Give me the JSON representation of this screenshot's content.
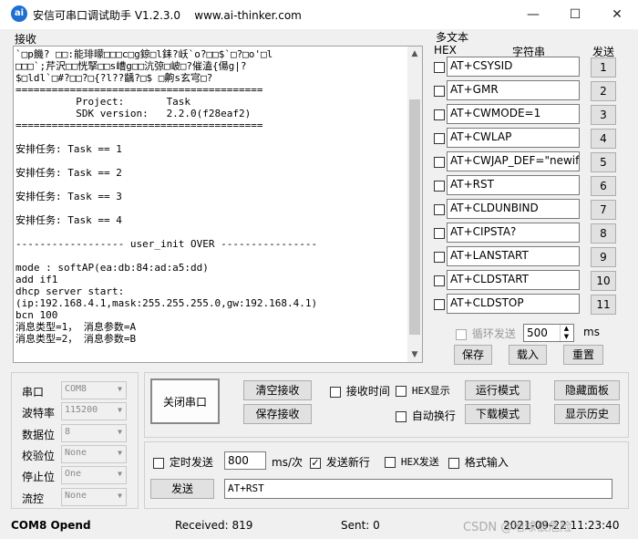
{
  "titlebar": {
    "icon_text": "ai",
    "title": "安信可串口调试助手 V1.2.3.0    www.ai-thinker.com",
    "minimize": "—",
    "maximize": "☐",
    "close": "✕"
  },
  "receive": {
    "label": "接收",
    "text": "`□p饑? □□:能琲曚□□□c□g鍄□l銇?岆`o?□□$`□?□o'□l\n□□□`;芹沢□□恍掔□□s嶆g□□沆弶□岥□?催溘{偒g|?\n$□ldl`□#?□□?□{?l??齲?□$ □齁s玄宆□?\n=========================================\n          Project:       Task\n          SDK version:   2.2.0(f28eaf2)\n=========================================\n\n安排任务: Task == 1\n\n安排任务: Task == 2\n\n安排任务: Task == 3\n\n安排任务: Task == 4\n\n------------------ user_init OVER ----------------\n\nmode : softAP(ea:db:84:ad:a5:dd)\nadd if1\ndhcp server start:\n(ip:192.168.4.1,mask:255.255.255.0,gw:192.168.4.1)\nbcn 100\n消息类型=1， 消息参数=A\n消息类型=2， 消息参数=B"
  },
  "multi_text": {
    "label": "多文本",
    "col_hex": "HEX",
    "col_string": "字符串",
    "col_send": "发送",
    "rows": [
      {
        "value": "AT+CSYSID",
        "num": "1"
      },
      {
        "value": "AT+GMR",
        "num": "2"
      },
      {
        "value": "AT+CWMODE=1",
        "num": "3"
      },
      {
        "value": "AT+CWLAP",
        "num": "4"
      },
      {
        "value": "AT+CWJAP_DEF=\"newifi_",
        "num": "5"
      },
      {
        "value": "AT+RST",
        "num": "6"
      },
      {
        "value": "AT+CLDUNBIND",
        "num": "7"
      },
      {
        "value": "AT+CIPSTA?",
        "num": "8"
      },
      {
        "value": "AT+LANSTART",
        "num": "9"
      },
      {
        "value": "AT+CLDSTART",
        "num": "10"
      },
      {
        "value": "AT+CLDSTOP",
        "num": "11"
      }
    ],
    "loop_label": "循环发送",
    "loop_value": "500",
    "loop_unit": "ms",
    "save": "保存",
    "load": "载入",
    "reset": "重置"
  },
  "port": {
    "port_label": "串口",
    "port_value": "COM8",
    "baud_label": "波特率",
    "baud_value": "115200",
    "data_label": "数据位",
    "data_value": "8",
    "parity_label": "校验位",
    "parity_value": "None",
    "stop_label": "停止位",
    "stop_value": "One",
    "flow_label": "流控",
    "flow_value": "None"
  },
  "controls": {
    "close_port": "关闭串口",
    "clear_recv": "清空接收",
    "save_recv": "保存接收",
    "recv_time": "接收时间",
    "hex_display": "HEX显示",
    "auto_wrap": "自动换行",
    "run_mode": "运行模式",
    "download_mode": "下载模式",
    "hide_panel": "隐藏面板",
    "show_history": "显示历史"
  },
  "send": {
    "timed_send": "定时发送",
    "interval_value": "800",
    "interval_unit": "ms/次",
    "newline": "发送新行",
    "hex_send": "HEX发送",
    "format_input": "格式输入",
    "send_button": "发送",
    "send_text": "AT+RST"
  },
  "status": {
    "port_state": "COM8 Opend",
    "received": "Received: 819",
    "sent": "Sent: 0",
    "time": "2021-09-22 11:23:40",
    "watermark": "CSDN @地球很危险"
  }
}
